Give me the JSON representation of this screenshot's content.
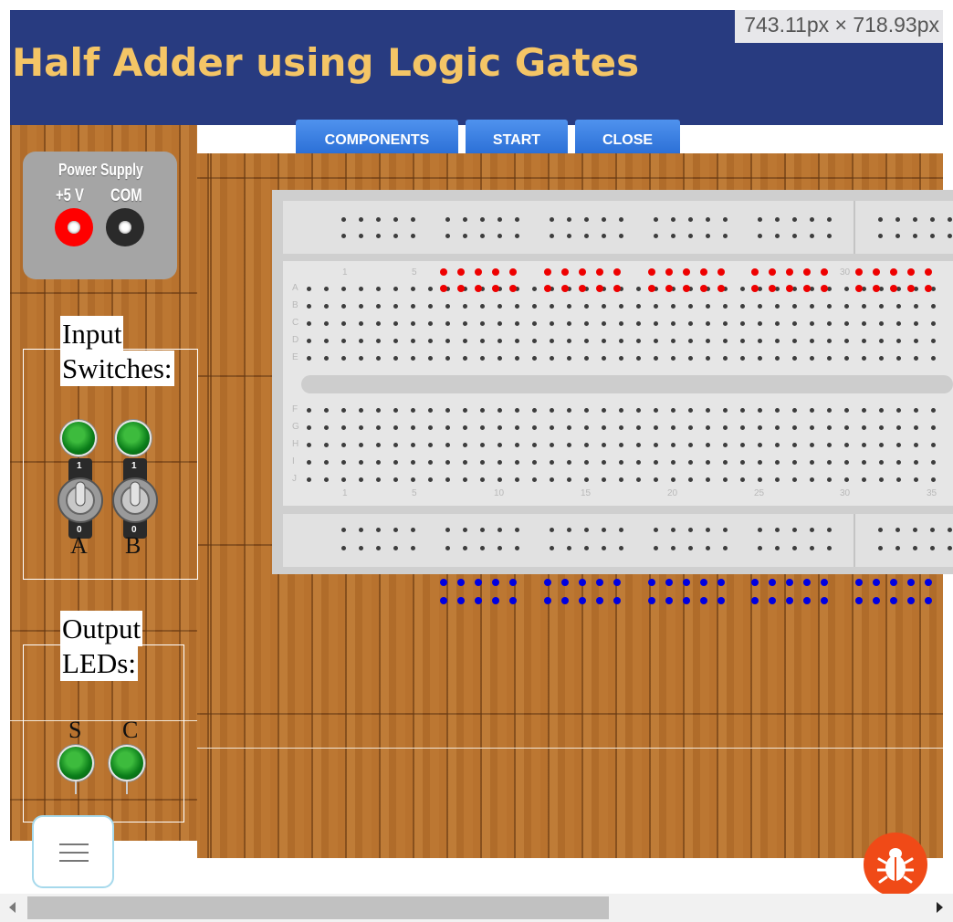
{
  "header": {
    "title": "Half Adder using Logic Gates",
    "dimension_tooltip": "743.11px × 718.93px"
  },
  "toolbar": {
    "components_label": "COMPONENTS",
    "start_label": "START",
    "close_label": "CLOSE"
  },
  "power_supply": {
    "title": "Power Supply",
    "pos_label": "+5 V",
    "com_label": "COM",
    "pos_color": "#ff0000",
    "com_color": "#2a2a2a"
  },
  "inputs": {
    "heading_line1": "Input",
    "heading_line2": "Switches:",
    "switches": [
      {
        "label": "A",
        "on_label": "1",
        "off_label": "0"
      },
      {
        "label": "B",
        "on_label": "1",
        "off_label": "0"
      }
    ]
  },
  "outputs": {
    "heading_line1": "Output",
    "heading_line2": "LEDs:",
    "leds": [
      {
        "label": "S"
      },
      {
        "label": "C"
      }
    ]
  },
  "breadboard": {
    "row_labels_top": [
      "A",
      "B",
      "C",
      "D",
      "E"
    ],
    "row_labels_bottom": [
      "F",
      "G",
      "H",
      "I",
      "J"
    ],
    "column_numbers": [
      "1",
      "5",
      "10",
      "15",
      "20",
      "25",
      "30",
      "35"
    ],
    "top_marker_color": "#ee0000",
    "bottom_marker_color": "#0000e0"
  },
  "colors": {
    "header_bg": "#283b80",
    "title_color": "#f4c566",
    "button_bg": "#3a80e2",
    "bug_button": "#f04a17"
  },
  "icons": {
    "menu": "hamburger-menu-icon",
    "bug": "bug-icon",
    "scroll_left": "arrow-left-icon",
    "scroll_right": "arrow-right-icon"
  }
}
